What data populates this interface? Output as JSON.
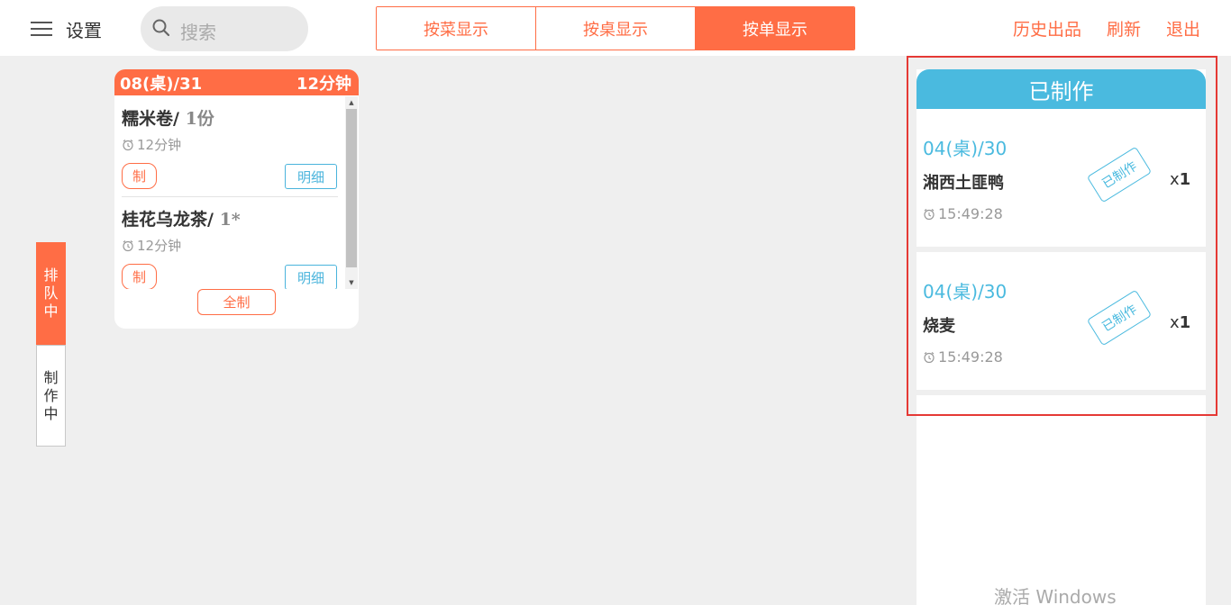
{
  "header": {
    "settings_label": "设置",
    "search_placeholder": "搜索",
    "view_tabs": [
      {
        "label": "按菜显示",
        "active": false
      },
      {
        "label": "按桌显示",
        "active": false
      },
      {
        "label": "按单显示",
        "active": true
      }
    ],
    "links": {
      "history": "历史出品",
      "refresh": "刷新",
      "logout": "退出"
    }
  },
  "side_tabs": {
    "queue": "排队中",
    "making": "制作中"
  },
  "order_card": {
    "table": "08(桌)/31",
    "elapsed": "12分钟",
    "items": [
      {
        "name": "糯米卷/",
        "qty": " 1份",
        "time": "12分钟",
        "make_label": "制",
        "detail_label": "明细"
      },
      {
        "name": "桂花乌龙茶/",
        "qty": " 1*",
        "time": "12分钟",
        "make_label": "制",
        "detail_label": "明细"
      }
    ],
    "make_all_label": "全制"
  },
  "done_panel": {
    "title": "已制作",
    "items": [
      {
        "table": "04(桌)/30",
        "name": "湘西土匪鸭",
        "time": "15:49:28",
        "stamp": "已制作",
        "count_prefix": "x",
        "count": "1"
      },
      {
        "table": "04(桌)/30",
        "name": "烧麦",
        "time": "15:49:28",
        "stamp": "已制作",
        "count_prefix": "x",
        "count": "1"
      }
    ]
  },
  "watermark": "激活 Windows",
  "colors": {
    "accent": "#ff6d45",
    "done_blue": "#4abadf",
    "highlight": "#e53935",
    "background": "#efefef"
  },
  "icons": {
    "menu": "hamburger-icon",
    "search": "search-icon",
    "clock": "alarm-clock-icon"
  }
}
